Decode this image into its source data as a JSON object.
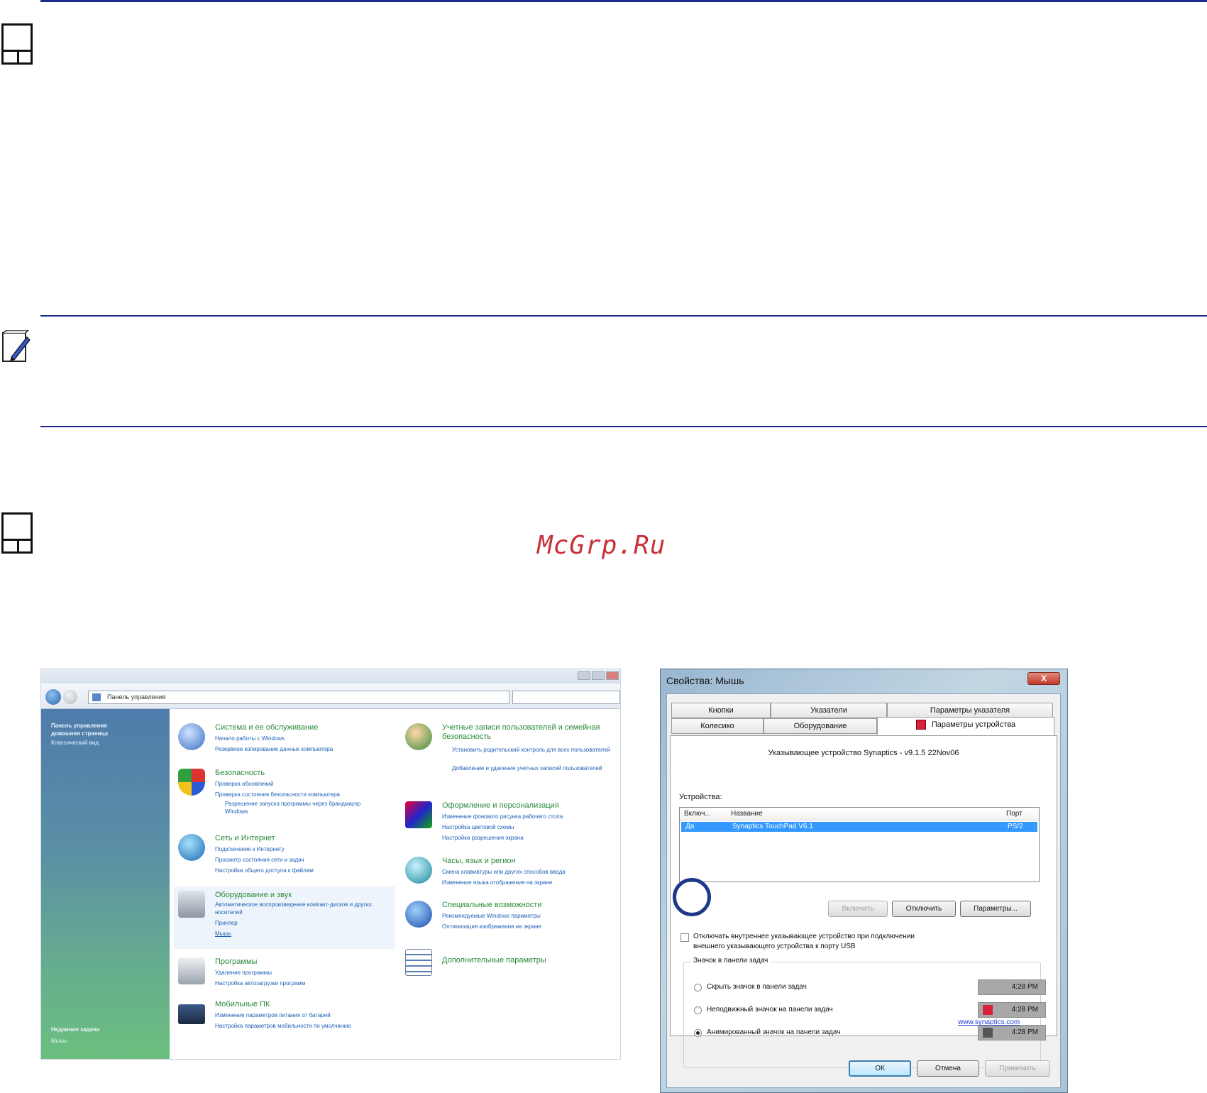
{
  "watermark": "McGrp.Ru",
  "control_panel": {
    "address": "Панель управления",
    "sidebar": {
      "home_link": "Панель управления домашняя страница",
      "classic_view": "Классический вид",
      "recent_tasks_title": "Недавние задачи",
      "recent_task": "Мышь"
    },
    "categories": [
      {
        "title": "Система и ее обслуживание",
        "links": [
          "Начало работы с Windows",
          "Резервное копирование данных компьютера"
        ]
      },
      {
        "title": "Безопасность",
        "links": [
          "Проверка обновлений",
          "Проверка состояния безопасности компьютера",
          "Разрешение запуска программы через брандмауэр Windows"
        ]
      },
      {
        "title": "Сеть и Интернет",
        "links": [
          "Подключение к Интернету",
          "Просмотр состояния сети и задач",
          "Настройка общего доступа к файлам"
        ]
      },
      {
        "title": "Оборудование и звук",
        "links": [
          "Автоматическое воспроизведение компакт-дисков и других носителей",
          "Принтер",
          "Мышь"
        ]
      },
      {
        "title": "Программы",
        "links": [
          "Удаление программы",
          "Настройка автозагрузки программ"
        ]
      },
      {
        "title": "Мобильные ПК",
        "links": [
          "Изменение параметров питания от батарей",
          "Настройка параметров мобильности по умолчанию"
        ]
      },
      {
        "title": "Учетные записи пользователей и семейная безопасность",
        "links": [
          "Установить родительский контроль для всех пользователей",
          "Добавление и удаление учетных записей пользователей"
        ]
      },
      {
        "title": "Оформление и персонализация",
        "links": [
          "Изменение фонового рисунка рабочего стола",
          "Настройка цветовой схемы",
          "Настройка разрешения экрана"
        ]
      },
      {
        "title": "Часы, язык и регион",
        "links": [
          "Смена клавиатуры или других способов ввода",
          "Изменение языка отображения на экране"
        ]
      },
      {
        "title": "Специальные возможности",
        "links": [
          "Рекомендуемые Windows параметры",
          "Оптимизация изображения на экране"
        ]
      },
      {
        "title": "Дополнительные параметры",
        "links": []
      }
    ]
  },
  "mouse_dialog": {
    "title": "Свойства: Мышь",
    "close_label": "X",
    "tabs_row1": [
      "Кнопки",
      "Указатели",
      "Параметры указателя"
    ],
    "tabs_row2": [
      "Колесико",
      "Оборудование",
      "Параметры устройства"
    ],
    "header": "Указывающее устройство Synaptics - v9.1.5 22Nov06",
    "devices_label": "Устройства:",
    "columns": [
      "Включ...",
      "Название",
      "Порт"
    ],
    "row": [
      "Да",
      "Synaptics TouchPad V6.1",
      "PS/2"
    ],
    "buttons": [
      "Включить",
      "Отключить",
      "Параметры..."
    ],
    "checkbox_text_line1": "Отключать внутреннее указывающее устройство при подключении",
    "checkbox_text_line2": "внешнего указывающего устройства к порту USB",
    "tray_group": "Значок в панели задач",
    "tray_options": [
      {
        "label": "Скрыть значок в панели задач",
        "time": "4:28 PM",
        "checked": false
      },
      {
        "label": "Неподвижный значок на панели задач",
        "time": "4:28 PM",
        "checked": false
      },
      {
        "label": "Анимированный значок на панели задач",
        "time": "4:28 PM",
        "checked": true
      }
    ],
    "website": "www.synaptics.com",
    "ok": "ОК",
    "cancel": "Отмена",
    "apply": "Применить"
  }
}
